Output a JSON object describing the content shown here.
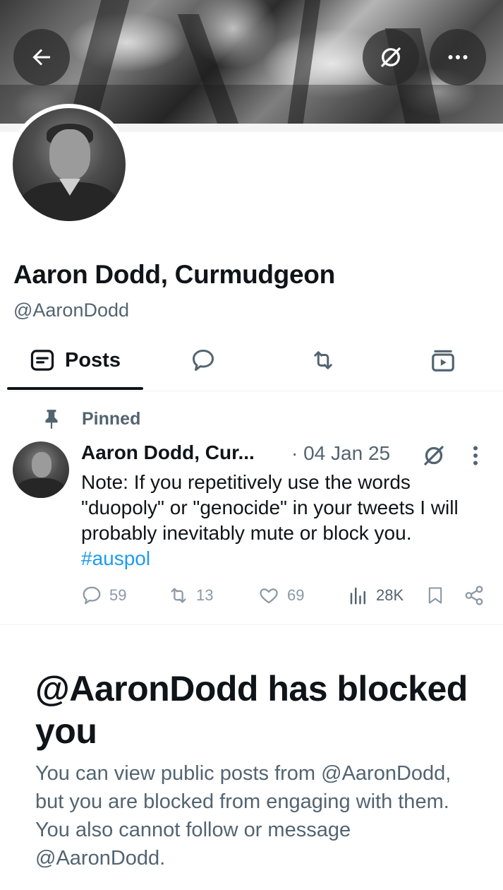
{
  "profile": {
    "name": "Aaron Dodd, Curmudgeon",
    "handle": "@AaronDodd"
  },
  "header": {
    "back_icon": "arrow-left-icon",
    "grok_icon": "grok-icon",
    "more_icon": "more-horizontal-icon"
  },
  "tabs": [
    {
      "label": "Posts",
      "icon": "posts-icon",
      "selected": true
    },
    {
      "label": "",
      "icon": "replies-icon",
      "selected": false
    },
    {
      "label": "",
      "icon": "reposts-icon",
      "selected": false
    },
    {
      "label": "",
      "icon": "media-icon",
      "selected": false
    }
  ],
  "pinned_post": {
    "pinned_label": "Pinned",
    "author": "Aaron Dodd, Cur...",
    "date": "· 04 Jan 25",
    "text_before_tag": "Note: If you repetitively use the words \"duopoly\" or \"genocide\" in your tweets I will probably inevitably mute or block you. ",
    "hashtag": "#auspol",
    "replies": "59",
    "reposts": "13",
    "likes": "69",
    "views": "28K"
  },
  "blocked": {
    "title": "@AaronDodd has blocked you",
    "description": "You can view public posts from @AaronDodd, but you are blocked from engaging with them. You also cannot follow or message @AaronDodd."
  },
  "colors": {
    "text": "#0f1419",
    "secondary": "#536471",
    "link": "#1d9bf0",
    "border": "#eff3f4"
  }
}
